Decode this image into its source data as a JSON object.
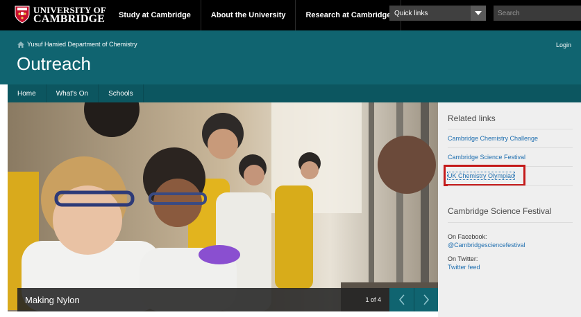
{
  "university": {
    "name_line1": "UNIVERSITY OF",
    "name_line2": "CAMBRIDGE"
  },
  "topnav": {
    "items": [
      {
        "label": "Study at Cambridge"
      },
      {
        "label": "About the University"
      },
      {
        "label": "Research at Cambridge"
      }
    ],
    "quick_links_label": "Quick links",
    "search_placeholder": "Search"
  },
  "header": {
    "breadcrumb": "Yusuf Hamied Department of Chemistry",
    "title": "Outreach",
    "login_label": "Login"
  },
  "section_nav": {
    "items": [
      {
        "label": "Home"
      },
      {
        "label": "What's On"
      },
      {
        "label": "Schools"
      }
    ]
  },
  "carousel": {
    "caption": "Making Nylon",
    "counter": "1 of 4"
  },
  "sidebar": {
    "related_heading": "Related links",
    "related_links": [
      {
        "label": "Cambridge Chemistry Challenge"
      },
      {
        "label": "Cambridge Science Festival"
      },
      {
        "label": "UK Chemistry Olympiad"
      }
    ],
    "festival_heading": "Cambridge Science Festival",
    "facebook_label": "On Facebook:",
    "facebook_link": "@Cambridgesciencefestival",
    "twitter_label": "On Twitter:",
    "twitter_link": "Twitter feed"
  },
  "colors": {
    "topbar": "#000000",
    "header_teal": "#106470",
    "nav_teal": "#0c5660",
    "link_blue": "#1f6fb0",
    "highlight_red": "#c41a1a"
  }
}
